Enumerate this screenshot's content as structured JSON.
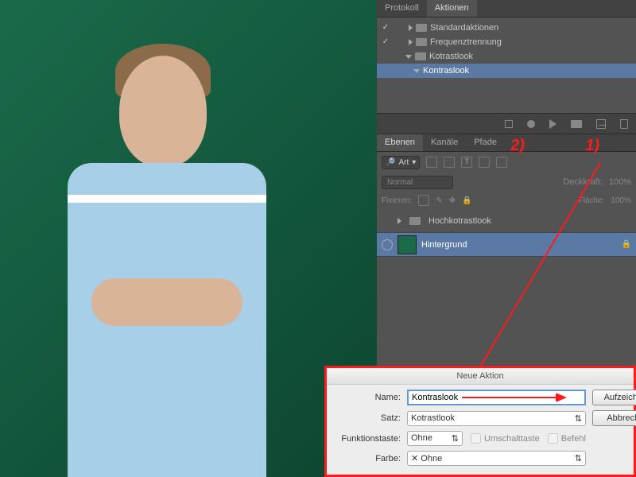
{
  "protokoll_tab": "Protokoll",
  "aktionen_tab": "Aktionen",
  "actions": {
    "standard": "Standardaktionen",
    "freq": "Frequenztrennung",
    "kotrast_set": "Kotrastlook",
    "kontras_action": "Kontraslook"
  },
  "layers_tabs": {
    "ebenen": "Ebenen",
    "kanaele": "Kanäle",
    "pfade": "Pfade"
  },
  "filter_mode": "Art",
  "blend": {
    "mode": "Normal",
    "opacity_label": "Deckkraft:",
    "opacity_val": "100%"
  },
  "lock": {
    "label": "Fixieren:",
    "fill_label": "Fläche:",
    "fill_val": "100%"
  },
  "layers": {
    "group": "Hochkotrastlook",
    "bg": "Hintergrund"
  },
  "annot": {
    "one": "1)",
    "two": "2)"
  },
  "dialog": {
    "title": "Neue Aktion",
    "name_label": "Name:",
    "name_value": "Kontraslook",
    "satz_label": "Satz:",
    "satz_value": "Kotrastlook",
    "fn_label": "Funktionstaste:",
    "fn_value": "Ohne",
    "shift": "Umschalttaste",
    "cmd": "Befehl",
    "farbe_label": "Farbe:",
    "farbe_value": "Ohne",
    "record": "Aufzeichnen",
    "cancel": "Abbrechen"
  }
}
